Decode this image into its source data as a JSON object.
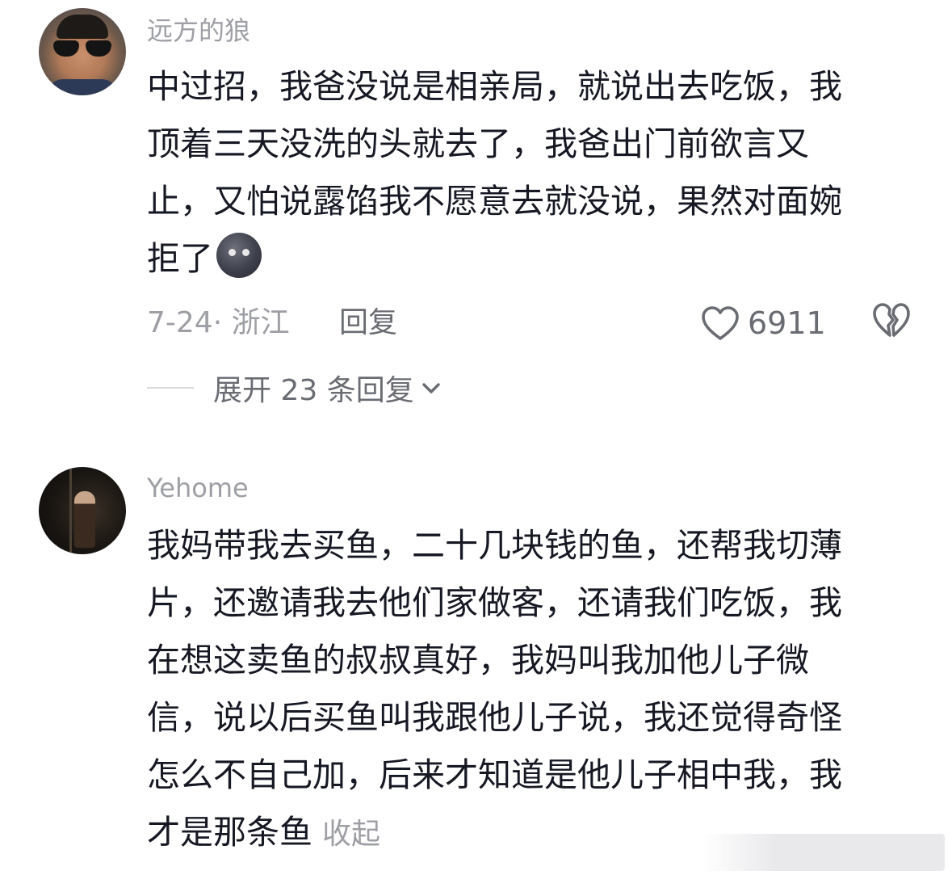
{
  "comments": [
    {
      "username": "远方的狼",
      "lines": [
        "中过招，我爸没说是相亲局，就说出去吃饭，我",
        "顶着三天没洗的头就去了，我爸出门前欲言又",
        "止，又怕说露馅我不愿意去就没说，果然对面婉",
        "拒了"
      ],
      "emoji": "new-moon-face-emoji",
      "date": "7-24",
      "location": "浙江",
      "reply_label": "回复",
      "like_count": "6911",
      "expand_label": "展开 23 条回复"
    },
    {
      "username": "Yehome",
      "lines": [
        "我妈带我去买鱼，二十几块钱的鱼，还帮我切薄",
        "片，还邀请我去他们家做客，还请我们吃饭，我",
        "在想这卖鱼的叔叔真好，我妈叫我加他儿子微",
        "信，说以后买鱼叫我跟他儿子说，我还觉得奇怪",
        "怎么不自己加，后来才知道是他儿子相中我，我",
        "才是那条鱼"
      ],
      "collapse_label": "收起"
    }
  ],
  "colors": {
    "text_primary": "#161823",
    "text_secondary": "#9d9fa5",
    "action": "#6a6c73"
  },
  "icons": [
    "heart-outline-icon",
    "broken-heart-icon",
    "chevron-down-icon"
  ]
}
